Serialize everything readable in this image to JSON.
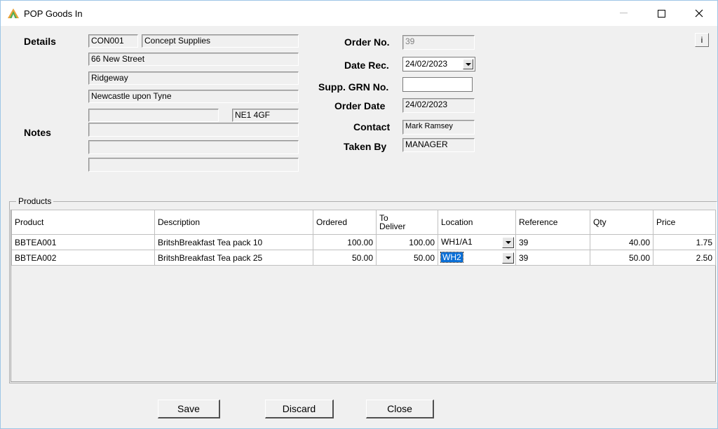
{
  "window": {
    "title": "POP Goods In",
    "min_label": "—",
    "max_label": "☐",
    "close_label": "✕"
  },
  "details": {
    "label": "Details",
    "supplier_code": "CON001",
    "supplier_name": "Concept Supplies",
    "address1": "66 New Street",
    "address2": "Ridgeway",
    "address3": "Newcastle upon Tyne",
    "address4": "",
    "postcode": "NE1 4GF"
  },
  "notes": {
    "label": "Notes",
    "line1": "",
    "line2": "",
    "line3": ""
  },
  "order": {
    "order_no_label": "Order No.",
    "order_no": "39",
    "date_rec_label": "Date Rec.",
    "date_rec": "24/02/2023",
    "supp_grn_label": "Supp. GRN No.",
    "supp_grn": "",
    "order_date_label": "Order Date",
    "order_date": "24/02/2023",
    "contact_label": "Contact",
    "contact": "Mark Ramsey",
    "taken_by_label": "Taken By",
    "taken_by": "MANAGER"
  },
  "info_button": "i",
  "products": {
    "group_label": "Products",
    "columns": [
      "Product",
      "Description",
      "Ordered",
      "To Deliver",
      "Location",
      "Reference",
      "Qty",
      "Price"
    ],
    "rows": [
      {
        "product": "BBTEA001",
        "description": "BritshBreakfast  Tea pack 10",
        "ordered": "100.00",
        "to_deliver": "100.00",
        "location": "WH1/A1",
        "reference": "39",
        "qty": "40.00",
        "price": "1.75"
      },
      {
        "product": "BBTEA002",
        "description": "BritshBreakfast  Tea pack 25",
        "ordered": "50.00",
        "to_deliver": "50.00",
        "location": "WH2",
        "reference": "39",
        "qty": "50.00",
        "price": "2.50"
      }
    ]
  },
  "buttons": {
    "save": "Save",
    "discard": "Discard",
    "close": "Close"
  },
  "icons": {
    "app": "pyramid-app-icon"
  },
  "colors": {
    "selection": "#0b6fd6",
    "title_border": "#9ec6e6"
  }
}
